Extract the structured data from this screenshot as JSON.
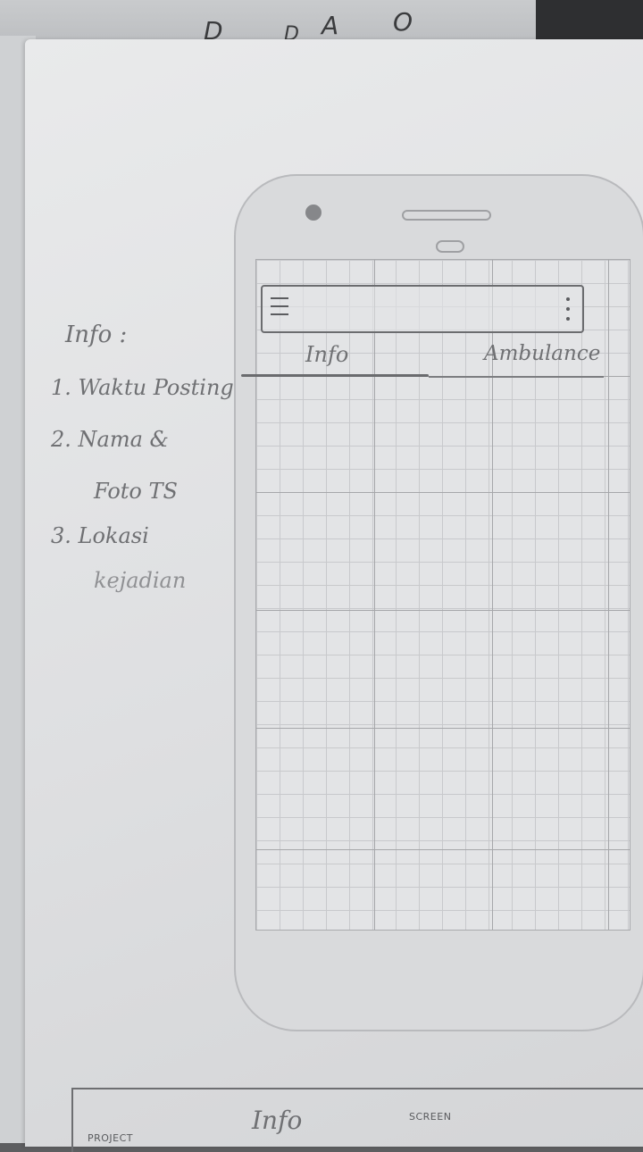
{
  "notes": {
    "title": "Info :",
    "items": [
      "1. Waktu Posting",
      "2. Nama &",
      "Foto TS",
      "3. Lokasi",
      "kejadian"
    ]
  },
  "phone": {
    "app_bar": {
      "menu_icon": "hamburger-menu-icon",
      "overflow_icon": "overflow-menu-icon"
    },
    "tabs": [
      {
        "label": "Info",
        "selected": true
      },
      {
        "label": "Ambulance",
        "selected": false
      }
    ]
  },
  "title_block": {
    "project_label": "PROJECT",
    "screen_label": "SCREEN",
    "project_value": "Info"
  },
  "background": {
    "symbols": [
      "D",
      "A",
      "D",
      "O"
    ]
  }
}
